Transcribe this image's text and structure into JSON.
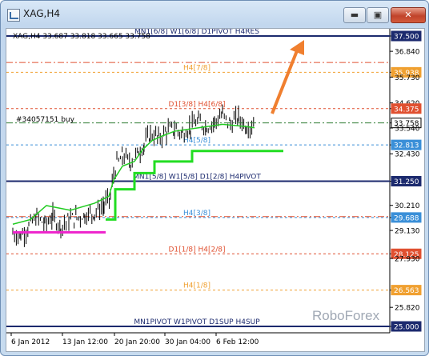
{
  "window": {
    "title": "XAG,H4",
    "minimize_glyph": "▬",
    "maximize_glyph": "▣",
    "close_glyph": "✕"
  },
  "chart": {
    "symbol_line": "XAG,H4  33.687 33.818 33.665 33.758",
    "order_label": "#34057151 buy",
    "watermark": "RoboForex",
    "arrow_color": "#f07f2f"
  },
  "chart_data": {
    "type": "bar",
    "price_axis": [
      "37.500",
      "36.840",
      "35.938",
      "35.730",
      "34.620",
      "34.375",
      "33.758",
      "33.540",
      "32.813",
      "32.430",
      "31.250",
      "30.210",
      "29.688",
      "29.130",
      "28.125",
      "27.930",
      "26.563",
      "25.820",
      "25.000"
    ],
    "time_axis": [
      "6 Jan 2012",
      "13 Jan 12:00",
      "20 Jan 20:00",
      "30 Jan 04:00",
      "6 Feb 12:00"
    ],
    "levels": [
      {
        "name": "MN1[6/8] W1[6/8] D1PIVOT H4RES",
        "price": "37.500",
        "color": "#1c2a6e",
        "style": "solid"
      },
      {
        "name": "H4[7/8]",
        "price": "35.938",
        "color": "#f0a030",
        "style": "dashed"
      },
      {
        "name": "D1[3/8] H4[6/8]",
        "price": "34.375",
        "color": "#e05030",
        "style": "dashed"
      },
      {
        "name": "H4[5/8]",
        "price": "32.813",
        "color": "#3a8fd8",
        "style": "dashed"
      },
      {
        "name": "MN1[5/8] W1[5/8] D1[2/8] H4PIVOT",
        "price": "31.250",
        "color": "#1c2a6e",
        "style": "solid"
      },
      {
        "name": "H4[3/8]",
        "price": "29.688",
        "color": "#3a8fd8",
        "style": "dashed"
      },
      {
        "name": "D1[1/8] H4[2/8]",
        "price": "28.125",
        "color": "#e05030",
        "style": "dashed"
      },
      {
        "name": "H4[1/8]",
        "price": "26.563",
        "color": "#f0a030",
        "style": "dashed"
      },
      {
        "name": "MN1PIVOT W1PIVOT D1SUP H4SUP",
        "price": "25.000",
        "color": "#1c2a6e",
        "style": "solid"
      }
    ],
    "current_price": "33.758"
  }
}
